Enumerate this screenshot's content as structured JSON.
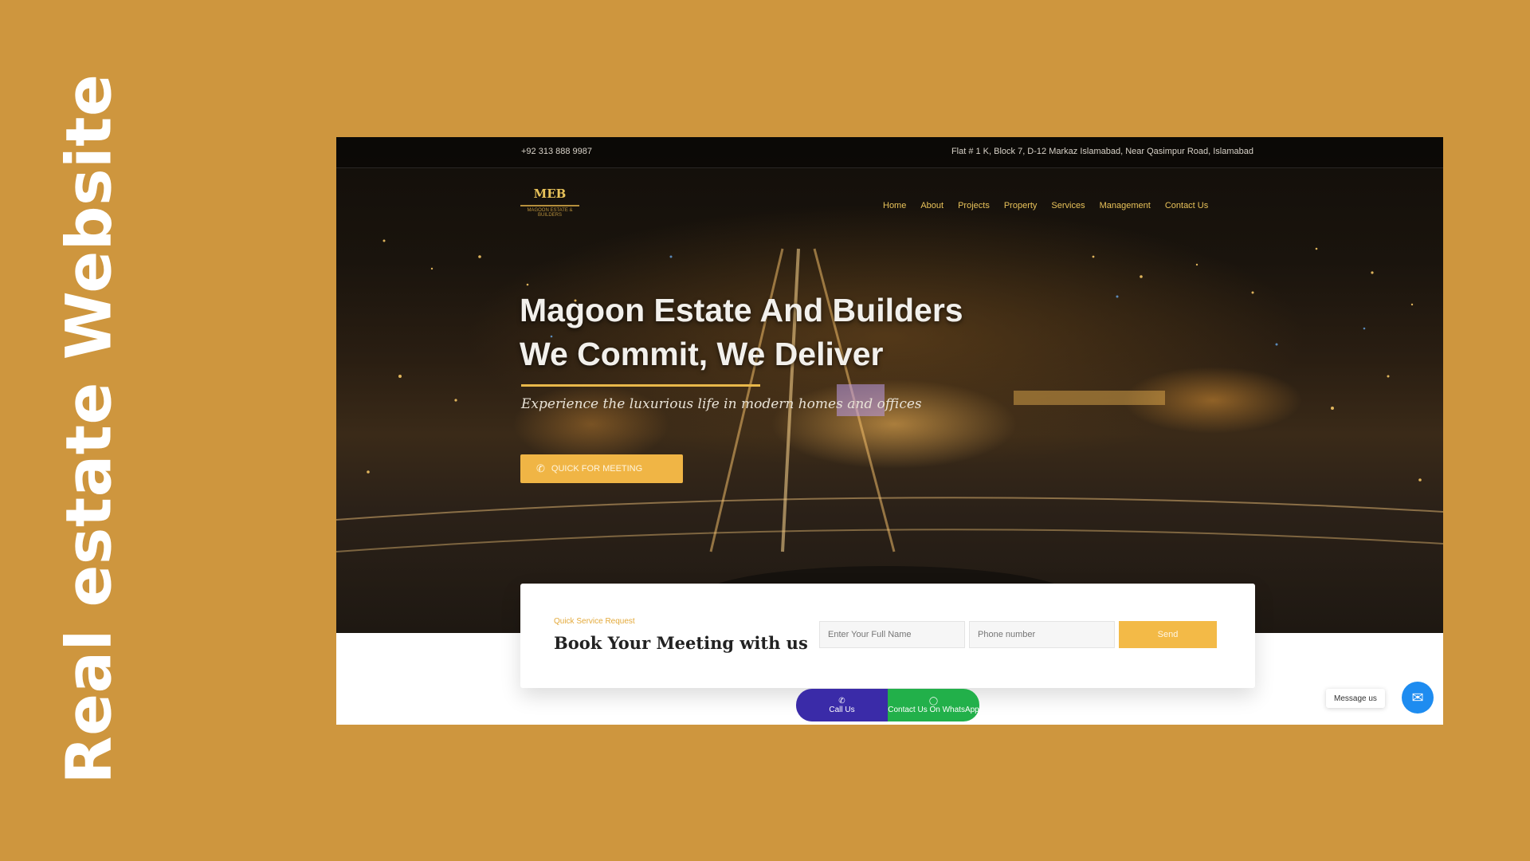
{
  "side_title": "Real estate Website",
  "topbar": {
    "phone": "+92 313 888 9987",
    "address": "Flat # 1 K, Block 7, D-12 Markaz Islamabad, Near Qasimpur Road, Islamabad"
  },
  "logo": {
    "mark": "MEB",
    "subtitle": "MAGOON ESTATE & BUILDERS"
  },
  "nav": {
    "items": [
      "Home",
      "About",
      "Projects",
      "Property",
      "Services",
      "Management",
      "Contact Us"
    ]
  },
  "hero": {
    "headline_line1": "Magoon Estate And Builders",
    "headline_line2": "We Commit, We Deliver",
    "tagline": "Experience the luxurious life in modern homes and offices",
    "cta_label": "QUICK FOR MEETING"
  },
  "booking": {
    "eyebrow": "Quick Service Request",
    "title": "Book Your Meeting with us",
    "name_placeholder": "Enter Your Full Name",
    "phone_placeholder": "Phone number",
    "send_label": "Send"
  },
  "floatbar": {
    "call_label": "Call Us",
    "whatsapp_label": "Contact Us On WhatsApp"
  },
  "messenger": {
    "label": "Message us"
  },
  "colors": {
    "background": "#CE963E",
    "accent_gold": "#F0B545",
    "call_purple": "#3A2BA8",
    "whatsapp_green": "#22B04A",
    "messenger_blue": "#1E8CF0"
  }
}
